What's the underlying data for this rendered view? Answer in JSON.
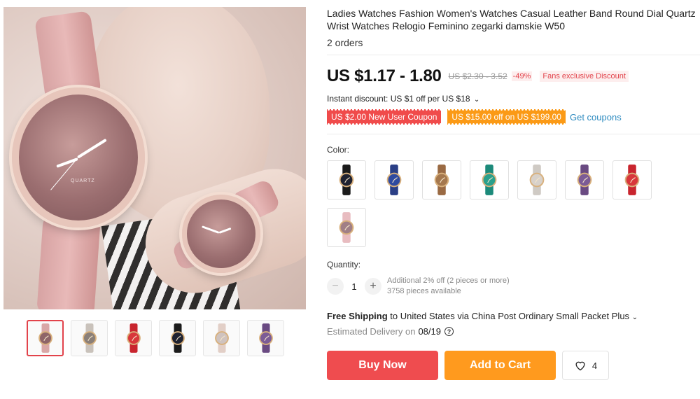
{
  "product": {
    "title": "Ladies Watches Fashion Women's Watches Casual Leather Band Round Dial Quartz Wrist Watches Relogio Feminino zegarki damskie W50",
    "orders": "2 orders",
    "main_image_brand": "QUARTZ"
  },
  "price": {
    "current": "US $1.17 - 1.80",
    "original": "US $2.30 - 3.52",
    "discount_pct": "-49%",
    "fans_discount": "Fans exclusive Discount",
    "instant_discount": "Instant discount: US $1 off per US $18",
    "coupon_new_user": "US $2.00 New User Coupon",
    "coupon_store": "US $15.00 off on US $199.00",
    "get_coupons": "Get coupons"
  },
  "color": {
    "label": "Color:",
    "options": [
      {
        "strap": "#1b1b1b",
        "face": "#1f2230"
      },
      {
        "strap": "#2a3f86",
        "face": "#2f4aa0"
      },
      {
        "strap": "#9a6a43",
        "face": "#a5784e"
      },
      {
        "strap": "#1c8a7a",
        "face": "#2aa08c"
      },
      {
        "strap": "#cfcac4",
        "face": "#d8d1ca"
      },
      {
        "strap": "#6a4a82",
        "face": "#7c5b96"
      },
      {
        "strap": "#c9252e",
        "face": "#d8373b"
      },
      {
        "strap": "#e8bcc0",
        "face": "#a07f86"
      }
    ]
  },
  "thumbnails": [
    {
      "strap": "#d9a7a6",
      "face": "#8e6468"
    },
    {
      "strap": "#c9c2bb",
      "face": "#8a7f78"
    },
    {
      "strap": "#c9252e",
      "face": "#d8373b"
    },
    {
      "strap": "#1b1b1b",
      "face": "#1f2230"
    },
    {
      "strap": "#e2cfc7",
      "face": "#cfc3bf"
    },
    {
      "strap": "#6a4a82",
      "face": "#7c5b96"
    }
  ],
  "quantity": {
    "label": "Quantity:",
    "value": "1",
    "minus": "−",
    "plus": "+",
    "bulk_note": "Additional 2% off (2 pieces or more)",
    "available": "3758 pieces available"
  },
  "shipping": {
    "free_label": "Free Shipping",
    "destination": " to United States via China Post Ordinary Small Packet Plus",
    "eta_label": "Estimated Delivery on",
    "eta_date": "08/19"
  },
  "actions": {
    "buy_now": "Buy Now",
    "add_to_cart": "Add to Cart",
    "wishlist_count": "4"
  },
  "colors": {
    "accent_red": "#ef4c4f",
    "accent_orange": "#ff9a1e",
    "link_blue": "#2e8bc0"
  }
}
